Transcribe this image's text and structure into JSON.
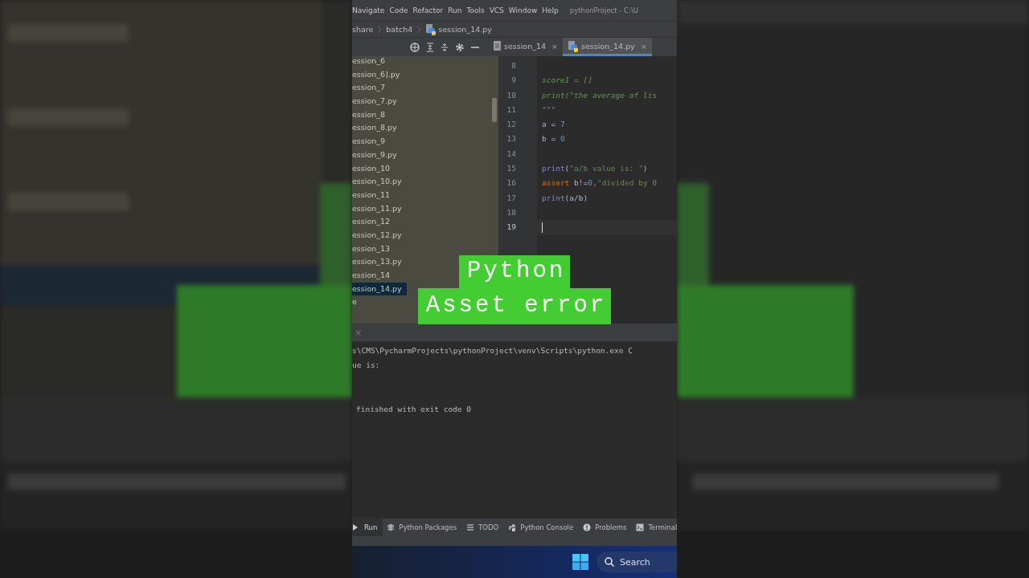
{
  "menu": {
    "items": [
      "Navigate",
      "Code",
      "Refactor",
      "Run",
      "Tools",
      "VCS",
      "Window",
      "Help"
    ],
    "title": "pythonProject - C:\\U"
  },
  "breadcrumb": [
    "share",
    "batch4",
    "session_14.py"
  ],
  "editor_tabs": [
    {
      "label": "session_14",
      "kind": "text",
      "close": "×",
      "selected": false
    },
    {
      "label": "session_14.py",
      "kind": "python",
      "close": "×",
      "selected": true
    }
  ],
  "project": {
    "items": [
      {
        "label": "ession_6",
        "selected": false
      },
      {
        "label": "ession_6].py",
        "selected": false
      },
      {
        "label": "ession_7",
        "selected": false
      },
      {
        "label": "ession_7.py",
        "selected": false
      },
      {
        "label": "ession_8",
        "selected": false
      },
      {
        "label": "ession_8.py",
        "selected": false
      },
      {
        "label": "ession_9",
        "selected": false
      },
      {
        "label": "ession_9.py",
        "selected": false
      },
      {
        "label": "ession_10",
        "selected": false
      },
      {
        "label": "ession_10.py",
        "selected": false
      },
      {
        "label": "ession_11",
        "selected": false
      },
      {
        "label": "ession_11.py",
        "selected": false
      },
      {
        "label": "ession_12",
        "selected": false
      },
      {
        "label": "ession_12.py",
        "selected": false
      },
      {
        "label": "ession_13",
        "selected": false
      },
      {
        "label": "ession_13.py",
        "selected": false
      },
      {
        "label": "ession_14",
        "selected": false
      },
      {
        "label": "ession_14.py",
        "selected": true
      },
      {
        "label": "e",
        "selected": false
      }
    ]
  },
  "code": [
    {
      "number": "8",
      "current": false
    },
    {
      "number": "9",
      "current": false,
      "tokens": [
        {
          "text": "score1 = []",
          "kind": "docstring"
        }
      ]
    },
    {
      "number": "10",
      "current": false,
      "tokens": [
        {
          "text": "print(\"the average of lis",
          "kind": "docstring"
        }
      ]
    },
    {
      "number": "11",
      "current": false,
      "tokens": [
        {
          "text": "\"\"\"",
          "kind": "docstring"
        }
      ]
    },
    {
      "number": "12",
      "current": false,
      "tokens": [
        {
          "text": "a = ",
          "kind": "plain"
        },
        {
          "text": "7",
          "kind": "number"
        }
      ]
    },
    {
      "number": "13",
      "current": false,
      "tokens": [
        {
          "text": "b = ",
          "kind": "plain"
        },
        {
          "text": "0",
          "kind": "number"
        }
      ]
    },
    {
      "number": "14",
      "current": false
    },
    {
      "number": "15",
      "current": false,
      "tokens": [
        {
          "text": "print",
          "kind": "builtin"
        },
        {
          "text": "(",
          "kind": "plain"
        },
        {
          "text": "\"a/b value is: \"",
          "kind": "string"
        },
        {
          "text": ")",
          "kind": "plain"
        }
      ]
    },
    {
      "number": "16",
      "current": false,
      "tokens": [
        {
          "text": "assert ",
          "kind": "keyword"
        },
        {
          "text": "b!=",
          "kind": "plain"
        },
        {
          "text": "0",
          "kind": "number"
        },
        {
          "text": ",",
          "kind": "keyword"
        },
        {
          "text": "\"divided by 0",
          "kind": "string"
        }
      ]
    },
    {
      "number": "17",
      "current": false,
      "tokens": [
        {
          "text": "print",
          "kind": "builtin"
        },
        {
          "text": "(a/b)",
          "kind": "plain"
        }
      ]
    },
    {
      "number": "18",
      "current": false
    },
    {
      "number": "19",
      "current": true
    }
  ],
  "run": {
    "close": "×",
    "output": [
      "s\\CMS\\PycharmProjects\\pythonProject\\venv\\Scripts\\python.exe C",
      "ue is:",
      "finished with exit code 0"
    ]
  },
  "tool_tabs": [
    {
      "label": "Run",
      "selected": true
    },
    {
      "label": "Python Packages",
      "selected": false
    },
    {
      "label": "TODO",
      "selected": false
    },
    {
      "label": "Python Console",
      "selected": false
    },
    {
      "label": "Problems",
      "selected": false
    },
    {
      "label": "Terminal",
      "selected": false
    }
  ],
  "taskbar": {
    "search": {
      "placeholder": "Search"
    }
  },
  "overlay": {
    "lines": [
      "Python",
      "Asset error"
    ]
  }
}
